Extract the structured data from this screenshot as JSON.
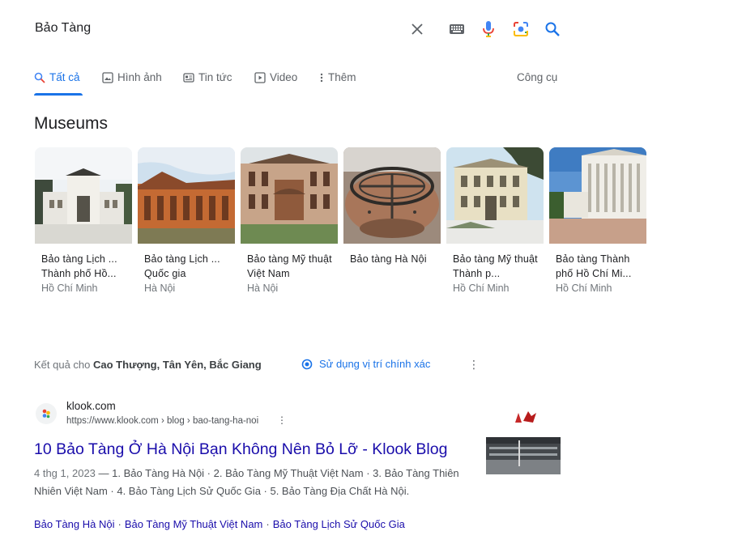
{
  "search": {
    "query": "Bảo Tàng"
  },
  "tabs": [
    {
      "label": "Tất cả"
    },
    {
      "label": "Hình ảnh"
    },
    {
      "label": "Tin tức"
    },
    {
      "label": "Video"
    },
    {
      "label": "Thêm"
    }
  ],
  "tools_label": "Công cụ",
  "museums": {
    "title": "Museums",
    "items": [
      {
        "name": "Bảo tàng Lịch ... Thành phố Hồ...",
        "location": "Hồ Chí Minh"
      },
      {
        "name": "Bảo tàng Lịch ... Quốc gia",
        "location": "Hà Nội"
      },
      {
        "name": "Bảo tàng Mỹ thuật Việt Nam",
        "location": "Hà Nội"
      },
      {
        "name": "Bảo tàng Hà Nội",
        "location": ""
      },
      {
        "name": "Bảo tàng Mỹ thuật Thành p...",
        "location": "Hồ Chí Minh"
      },
      {
        "name": "Bảo tàng Thành phố Hồ Chí Mi...",
        "location": "Hồ Chí Minh"
      }
    ]
  },
  "location": {
    "prefix": "Kết quả cho",
    "place": "Cao Thượng, Tân Yên, Bắc Giang",
    "precise_label": "Sử dụng vị trí chính xác"
  },
  "result": {
    "site_name": "klook.com",
    "url": "https://www.klook.com › blog › bao-tang-ha-noi",
    "title": "10 Bảo Tàng Ở Hà Nội Bạn Không Nên Bỏ Lỡ - Klook Blog",
    "date": "4 thg 1, 2023",
    "snippet": " — 1. Bảo Tàng Hà Nội · 2. Bảo Tàng Mỹ Thuật Việt Nam · 3. Bảo Tàng Thiên Nhiên Việt Nam · 4. Bảo Tàng Lịch Sử Quốc Gia · 5. Bảo Tàng Địa Chất Hà Nội.",
    "sitelinks": [
      "Bảo Tàng Hà Nội",
      "Bảo Tàng Mỹ Thuật Việt Nam",
      "Bảo Tàng Lịch Sử Quốc Gia"
    ]
  },
  "colors": {
    "accent": "#1a73e8",
    "link": "#1a0dab",
    "text": "#202124",
    "muted": "#70757a"
  }
}
